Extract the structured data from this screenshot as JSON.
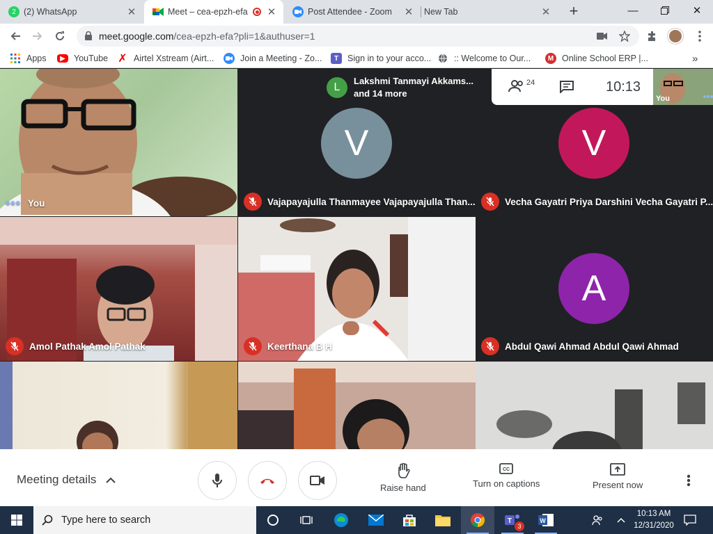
{
  "browser": {
    "tabs": [
      {
        "title": "(2) WhatsApp",
        "badge": "2",
        "favicon": "whatsapp-icon"
      },
      {
        "title": "Meet – cea-epzh-efa",
        "favicon": "meet-icon",
        "recording": true
      },
      {
        "title": "Post Attendee - Zoom",
        "favicon": "zoom-icon"
      },
      {
        "title": "New Tab",
        "favicon": ""
      }
    ],
    "url_host": "meet.google.com",
    "url_path": "/cea-epzh-efa?pli=1&authuser=1",
    "bookmarks": [
      {
        "label": "Apps",
        "icon": "apps-grid-icon"
      },
      {
        "label": "YouTube",
        "icon": "youtube-icon"
      },
      {
        "label": "Airtel Xstream (Airt...",
        "icon": "airtel-icon"
      },
      {
        "label": "Join a Meeting - Zo...",
        "icon": "zoom-icon"
      },
      {
        "label": "Sign in to your acco...",
        "icon": "teams-icon"
      },
      {
        "label": ":: Welcome to Our...",
        "icon": "globe-icon"
      },
      {
        "label": "Online School ERP |...",
        "icon": "erp-icon"
      }
    ],
    "bookmarks_overflow": "»"
  },
  "meet": {
    "presenter_line1": "Lakshmi Tanmayi Akkams...",
    "presenter_line2": "and 14 more",
    "presenter_initial": "L",
    "participant_count": "24",
    "clock": "10:13",
    "selfview_label": "You",
    "tiles": [
      {
        "name": "You",
        "type": "video",
        "muted": false
      },
      {
        "name": "Vajapayajulla Thanmayee Vajapayajulla Than...",
        "type": "avatar",
        "initial": "V",
        "color": "#78909c",
        "muted": true
      },
      {
        "name": "Vecha Gayatri Priya Darshini Vecha Gayatri P...",
        "type": "avatar",
        "initial": "V",
        "color": "#c2185b",
        "muted": true
      },
      {
        "name": "Amol Pathak Amol Pathak",
        "type": "video",
        "muted": true
      },
      {
        "name": "Keerthana B H",
        "type": "video",
        "muted": true
      },
      {
        "name": "Abdul Qawi Ahmad Abdul Qawi Ahmad",
        "type": "avatar",
        "initial": "A",
        "color": "#8e24aa",
        "muted": true
      },
      {
        "name": "",
        "type": "video",
        "muted": false
      },
      {
        "name": "",
        "type": "video",
        "muted": false
      },
      {
        "name": "",
        "type": "video",
        "muted": false
      }
    ]
  },
  "controls": {
    "meeting_details": "Meeting details",
    "raise_hand": "Raise hand",
    "captions": "Turn on captions",
    "present": "Present now"
  },
  "taskbar": {
    "search_placeholder": "Type here to search",
    "teams_badge": "3",
    "time": "10:13 AM",
    "date": "12/31/2020"
  }
}
